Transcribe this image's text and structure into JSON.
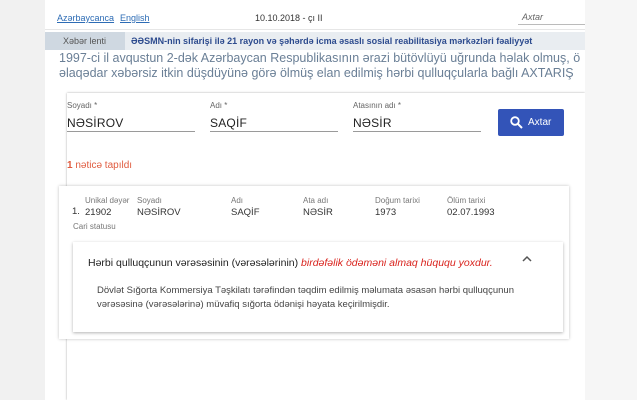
{
  "topbar": {
    "lang_az": "Azərbaycanca",
    "lang_en": "English",
    "date": "10.10.2018 - çı II",
    "search_placeholder": "Axtar"
  },
  "ticker": {
    "label": "Xəbər lenti",
    "text": "ƏƏSMN-nin sifarişi ilə 21 rayon və şəhərdə icma əsaslı sosial reabilitasiya mərkəzləri fəaliyyət"
  },
  "intro": {
    "line1": "1997-ci il avqustun 2-dək Azərbaycan Respublikasının ərazi bütövlüyü uğrunda həlak olmuş, ö",
    "line2": "əlaqədar xəbərsiz itkin düşdüyünə görə ölmüş elan edilmiş hərbi qulluqçularla bağlı AXTARIŞ"
  },
  "form": {
    "surname_label": "Soyadı *",
    "surname_value": "NƏSİROV",
    "name_label": "Adı *",
    "name_value": "SAQİF",
    "father_label": "Atasının adı *",
    "father_value": "NƏSİR",
    "search_button": "Axtar"
  },
  "results": {
    "count": "1",
    "count_text": "nəticə tapıldı",
    "headers": {
      "id": "Unikal dəyər",
      "surname": "Soyadı",
      "name": "Adı",
      "father": "Ata adı",
      "birth": "Doğum tarixi",
      "death": "Ölüm tarixi",
      "status": "Cari statusu"
    },
    "row": {
      "num": "1.",
      "id": "21902",
      "surname": "NƏSİROV",
      "name": "SAQİF",
      "father": "NƏSİR",
      "birth": "1973",
      "death": "02.07.1993"
    }
  },
  "notice": {
    "title_prefix": "Hərbi qulluqçunun vərəsəsinin (vərəsələrinin)",
    "title_red": "birdəfəlik ödəməni almaq hüququ yoxdur.",
    "body": "Dövlət Sığorta Kommersiya Təşkilatı tərəfindən təqdim edilmiş məlumata əsasən hərbi qulluqçunun vərəsəsinə (vərəsələrinə) müvafiq sığorta ödənişi həyata keçirilmişdir."
  },
  "colors": {
    "accent": "#3354b8",
    "result_red": "#e05b3f",
    "notice_red": "#d9231d",
    "intro_text": "#6a7f96"
  }
}
